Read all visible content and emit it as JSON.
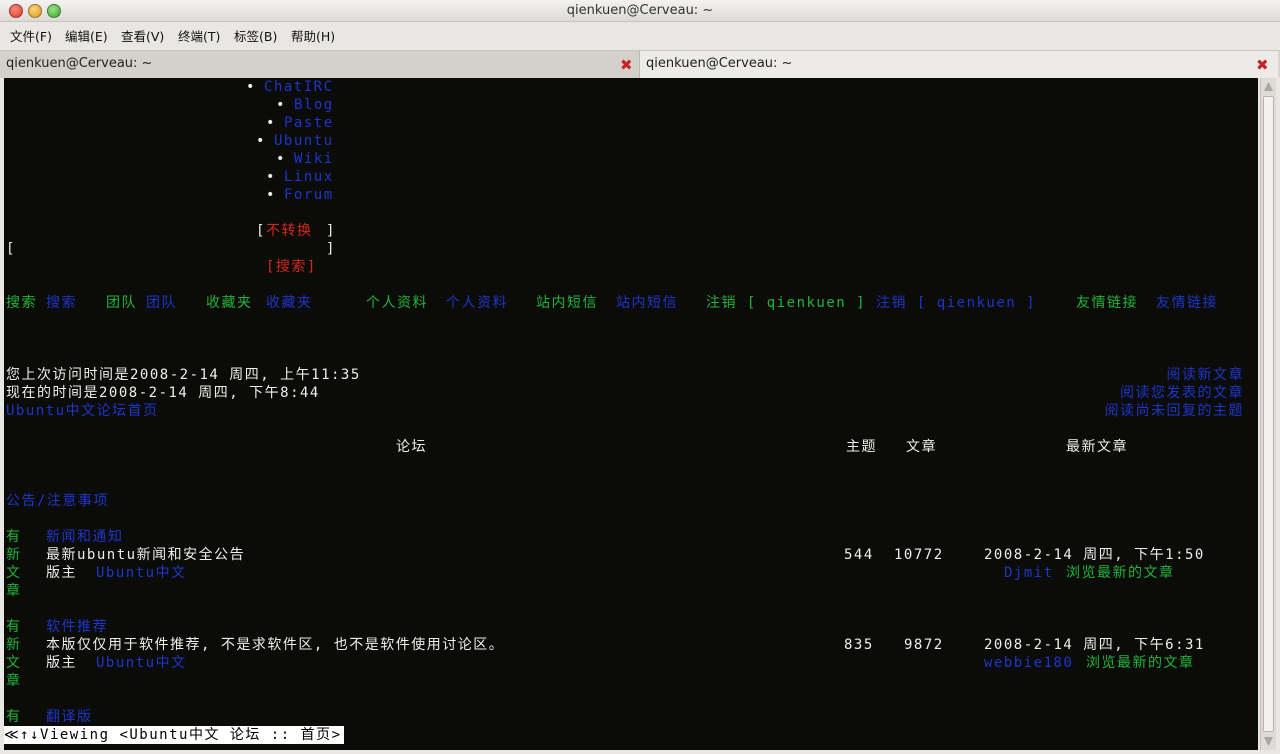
{
  "window": {
    "title": "qienkuen@Cerveau: ~"
  },
  "menu": [
    "文件(F)",
    "编辑(E)",
    "查看(V)",
    "终端(T)",
    "标签(B)",
    "帮助(H)"
  ],
  "tabs": [
    "qienkuen@Cerveau: ~",
    "qienkuen@Cerveau: ~"
  ],
  "tab_close": "✖",
  "nav": [
    "ChatIRC",
    "Blog",
    "Paste",
    "Ubuntu",
    "Wiki",
    "Linux",
    "Forum"
  ],
  "bullet": "•",
  "convert": {
    "open": "[",
    "label": "不转换",
    "close": "]"
  },
  "search_box": {
    "open": "[",
    "close": "]",
    "label": "[搜索]"
  },
  "toolbar": {
    "search": "搜索",
    "search_link": "搜索",
    "team": "团队",
    "team_link": "团队",
    "fav": "收藏夹",
    "fav_link": "收藏夹",
    "profile": "个人资料",
    "profile_link": "个人资料",
    "pm": "站内短信",
    "pm_link": "站内短信",
    "logout": "注销 [ qienkuen ]",
    "logout_link": "注销 [ qienkuen ]",
    "links": "友情链接",
    "links_link": "友情链接"
  },
  "visit": {
    "last": "您上次访问时间是2008-2-14 周四, 上午11:35",
    "now": "现在的时间是2008-2-14 周四, 下午8:44",
    "home": "Ubuntu中文论坛首页",
    "read_new": "阅读新文章",
    "read_mine": "阅读您发表的文章",
    "read_unanswered": "阅读尚未回复的主题"
  },
  "table_header": {
    "forum": "论坛",
    "topics": "主题",
    "posts": "文章",
    "latest": "最新文章"
  },
  "category": "公告/注意事项",
  "forums": [
    {
      "status": [
        "有",
        "新",
        "文",
        "章"
      ],
      "name": "新闻和通知",
      "desc": "最新ubuntu新闻和安全公告",
      "moderator_label": "版主",
      "moderator": "Ubuntu中文",
      "topics": "544",
      "posts": "10772",
      "last_time": "2008-2-14 周四, 下午1:50",
      "last_user": "Djmit",
      "browse": "浏览最新的文章"
    },
    {
      "status": [
        "有",
        "新",
        "文",
        "章"
      ],
      "name": "软件推荐",
      "desc": "本版仅仅用于软件推荐, 不是求软件区, 也不是软件使用讨论区。",
      "moderator_label": "版主",
      "moderator": "Ubuntu中文",
      "topics": "835",
      "posts": "9872",
      "last_time": "2008-2-14 周四, 下午6:31",
      "last_user": "webbie180",
      "browse": "浏览最新的文章"
    }
  ],
  "partial_forum": {
    "status": "有",
    "name": "翻译版"
  },
  "statusbar": "≪↑↓Viewing <Ubuntu中文 论坛 :: 首页>"
}
